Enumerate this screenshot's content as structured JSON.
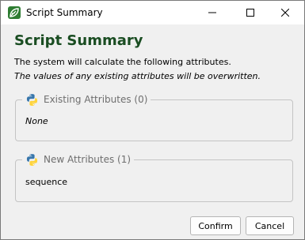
{
  "window": {
    "title": "Script Summary",
    "icon": "leaf-app-icon",
    "controls": [
      "minimize-icon",
      "maximize-icon",
      "close-icon"
    ]
  },
  "content": {
    "heading": "Script Summary",
    "description": "The system will calculate the following attributes.",
    "warning": "The values of any existing attributes will be overwritten."
  },
  "existing_attributes": {
    "label": "Existing Attributes (0)",
    "icon": "python-icon",
    "value": "None"
  },
  "new_attributes": {
    "label": "New Attributes (1)",
    "icon": "python-icon",
    "value": "sequence"
  },
  "buttons": {
    "confirm": "Confirm",
    "cancel": "Cancel"
  },
  "colors": {
    "heading": "#1a4d22",
    "app_icon": "#2e7d32",
    "python_blue": "#3776ab",
    "python_yellow": "#ffd43b"
  }
}
